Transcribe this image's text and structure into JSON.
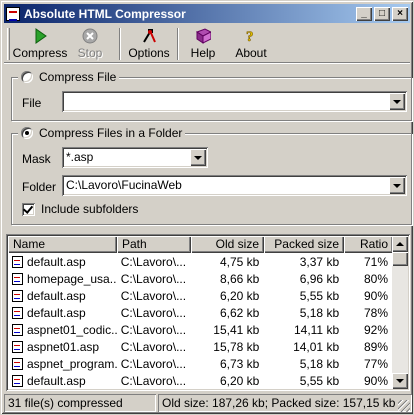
{
  "window": {
    "title": "Absolute HTML Compressor",
    "minimize_glyph": "_",
    "maximize_glyph": "□",
    "close_glyph": "×"
  },
  "toolbar": {
    "buttons": [
      {
        "label": "Compress",
        "icon": "play-icon",
        "enabled": true
      },
      {
        "label": "Stop",
        "icon": "stop-icon",
        "enabled": false
      },
      {
        "label": "Options",
        "icon": "options-icon",
        "enabled": true
      },
      {
        "label": "Help",
        "icon": "help-book-icon",
        "enabled": true
      },
      {
        "label": "About",
        "icon": "about-icon",
        "enabled": true
      }
    ]
  },
  "compress_file": {
    "legend": "Compress File",
    "selected": false,
    "file_label": "File",
    "file_value": ""
  },
  "compress_folder": {
    "legend": "Compress Files in a Folder",
    "selected": true,
    "mask_label": "Mask",
    "mask_value": "*.asp",
    "folder_label": "Folder",
    "folder_value": "C:\\Lavoro\\FucinaWeb",
    "subfolders_label": "Include subfolders",
    "subfolders_checked": true
  },
  "list": {
    "columns": [
      "Name",
      "Path",
      "Old size",
      "Packed size",
      "Ratio"
    ],
    "rows": [
      [
        "default.asp",
        "C:\\Lavoro\\...",
        "4,75 kb",
        "3,37 kb",
        "71%"
      ],
      [
        "homepage_usa...",
        "C:\\Lavoro\\...",
        "8,66 kb",
        "6,96 kb",
        "80%"
      ],
      [
        "default.asp",
        "C:\\Lavoro\\...",
        "6,20 kb",
        "5,55 kb",
        "90%"
      ],
      [
        "default.asp",
        "C:\\Lavoro\\...",
        "6,62 kb",
        "5,18 kb",
        "78%"
      ],
      [
        "aspnet01_codic...",
        "C:\\Lavoro\\...",
        "15,41 kb",
        "14,11 kb",
        "92%"
      ],
      [
        "aspnet01.asp",
        "C:\\Lavoro\\...",
        "15,78 kb",
        "14,01 kb",
        "89%"
      ],
      [
        "aspnet_program...",
        "C:\\Lavoro\\...",
        "6,73 kb",
        "5,18 kb",
        "77%"
      ],
      [
        "default.asp",
        "C:\\Lavoro\\...",
        "6,20 kb",
        "5,55 kb",
        "90%"
      ]
    ]
  },
  "status": {
    "files": "31 file(s) compressed",
    "sizes": "Old size: 187,26 kb;  Packed size: 157,15 kb"
  }
}
